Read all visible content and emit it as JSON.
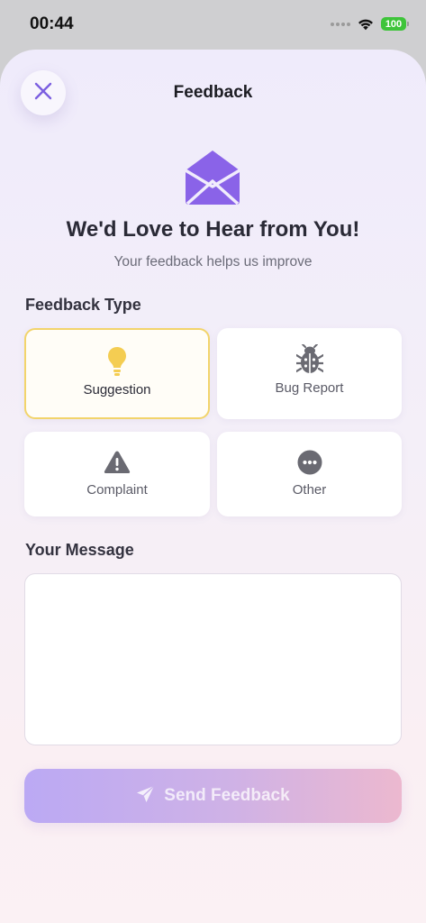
{
  "status_bar": {
    "time": "00:44",
    "battery": "100",
    "icons": [
      "signal-dots-icon",
      "wifi-icon",
      "battery-icon"
    ]
  },
  "header": {
    "title": "Feedback",
    "close_icon": "close-icon"
  },
  "hero": {
    "icon": "envelope-open-icon",
    "title": "We'd Love to Hear from You!",
    "subtitle": "Your feedback helps us improve"
  },
  "feedback_type": {
    "label": "Feedback Type",
    "selected": "Suggestion",
    "options": [
      {
        "label": "Suggestion",
        "icon": "lightbulb-icon"
      },
      {
        "label": "Bug Report",
        "icon": "bug-icon"
      },
      {
        "label": "Complaint",
        "icon": "warning-icon"
      },
      {
        "label": "Other",
        "icon": "more-dots-icon"
      }
    ]
  },
  "message": {
    "label": "Your Message",
    "value": "",
    "placeholder": ""
  },
  "send_button": {
    "label": "Send Feedback",
    "icon": "paper-plane-icon"
  },
  "colors": {
    "accent": "#8a63e8",
    "selected_border": "#f2d46b",
    "lightbulb": "#f4cd52",
    "icon_gray": "#6a6a72",
    "battery": "#3ec43a"
  }
}
